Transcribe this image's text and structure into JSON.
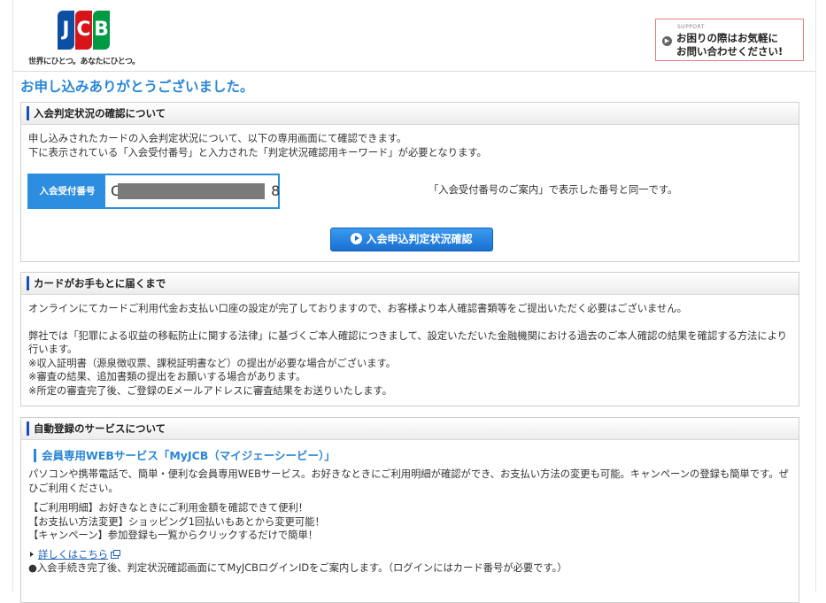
{
  "header": {
    "logo_text": [
      "J",
      "C",
      "B"
    ],
    "tagline": "世界にひとつ。あなたにひとつ。",
    "support_label": "SUPPORT",
    "support_lines": [
      "お困りの際はお気軽に",
      "お問い合わせください!"
    ]
  },
  "page_title": "お申し込みありがとうございました。",
  "section1": {
    "title": "入会判定状況の確認について",
    "body_lines": [
      "申し込みされたカードの入会判定状況について、以下の専用画面にて確認できます。",
      "下に表示されている「入会受付番号」と入力された「判定状況確認用キーワード」が必要となります。"
    ],
    "appnum_label": "入会受付番号",
    "appnum_start": "C",
    "appnum_end": "8",
    "appnum_note": "「入会受付番号のご案内」で表示した番号と同一です。",
    "button_label": "入会申込判定状況確認"
  },
  "section2": {
    "title": "カードがお手もとに届くまで",
    "para1": "オンラインにてカードご利用代金お支払い口座の設定が完了しておりますので、お客様より本人確認書類等をご提出いただく必要はございません。",
    "para2": "弊社では「犯罪による収益の移転防止に関する法律」に基づくご本人確認につきまして、設定いただいた金融機関における過去のご本人確認の結果を確認する方法により行います。",
    "notes": [
      "※収入証明書（源泉徴収票、課税証明書など）の提出が必要な場合がございます。",
      "※審査の結果、追加書類の提出をお願いする場合があります。",
      "※所定の審査完了後、ご登録のEメールアドレスに審査結果をお送りいたします。"
    ]
  },
  "section3": {
    "title": "自動登録のサービスについて",
    "myjcb_title": "会員専用WEBサービス「MyJCB（マイジェーシービー）」",
    "myjcb_desc": "パソコンや携帯電話で、簡単・便利な会員専用WEBサービス。お好きなときにご利用明細が確認ができ、お支払い方法の変更も可能。キャンペーンの登録も簡単です。ぜひご利用ください。",
    "features": [
      "【ご利用明細】お好きなときにご利用金額を確認できて便利！",
      "【お支払い方法変更】ショッピング1回払いもあとから変更可能！",
      "【キャンペーン】参加登録も一覧からクリックするだけで簡単！"
    ],
    "more_link": "詳しくはこちら",
    "last_line": "●入会手続き完了後、判定状況確認画面にてMyJCBログインIDをご案内します。（ログインにはカード番号が必要です。）"
  }
}
